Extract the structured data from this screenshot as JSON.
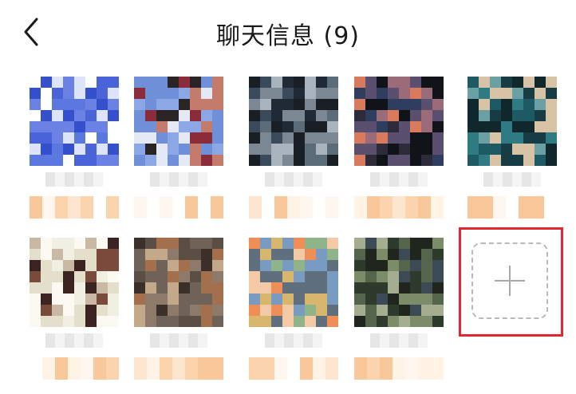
{
  "header": {
    "back_icon": "chevron-left-icon",
    "title": "聊天信息 (9)"
  },
  "members": [
    {
      "palette": [
        "#4a63d8",
        "#5a78e0",
        "#ffffff",
        "#dde4fb",
        "#6b82e4",
        "#3550cc"
      ]
    },
    {
      "palette": [
        "#6f8fd8",
        "#8ba7e6",
        "#2a2424",
        "#8a2c3a",
        "#c47b6b",
        "#e5e9f5"
      ]
    },
    {
      "palette": [
        "#1f2a36",
        "#3b4a5a",
        "#5c6b78",
        "#a9b3bd",
        "#1a1f25",
        "#7b8793"
      ]
    },
    {
      "palette": [
        "#101418",
        "#2d2a3a",
        "#d97a5d",
        "#5a4f6e",
        "#9b6b7a",
        "#2f3e5e"
      ]
    },
    {
      "palette": [
        "#1d5a63",
        "#2f7b84",
        "#173c43",
        "#6aa0a4",
        "#d9c3a6",
        "#10282c"
      ]
    },
    {
      "palette": [
        "#f1efe2",
        "#e4dfcb",
        "#3a2320",
        "#7a4b3c",
        "#c9b8a3",
        "#fbf9f2"
      ]
    },
    {
      "palette": [
        "#5b4e45",
        "#8e7a6a",
        "#3b2f29",
        "#c3a88a",
        "#a46f4d",
        "#6e6259"
      ]
    },
    {
      "palette": [
        "#f08e58",
        "#d8b66e",
        "#7a9bc1",
        "#5f6f7d",
        "#f3c9a6",
        "#8fb489"
      ]
    },
    {
      "palette": [
        "#2e3a2b",
        "#55654b",
        "#7c8b68",
        "#3c4a55",
        "#a4ad8f",
        "#20261d"
      ]
    }
  ],
  "add_member": {
    "icon": "plus-icon"
  }
}
